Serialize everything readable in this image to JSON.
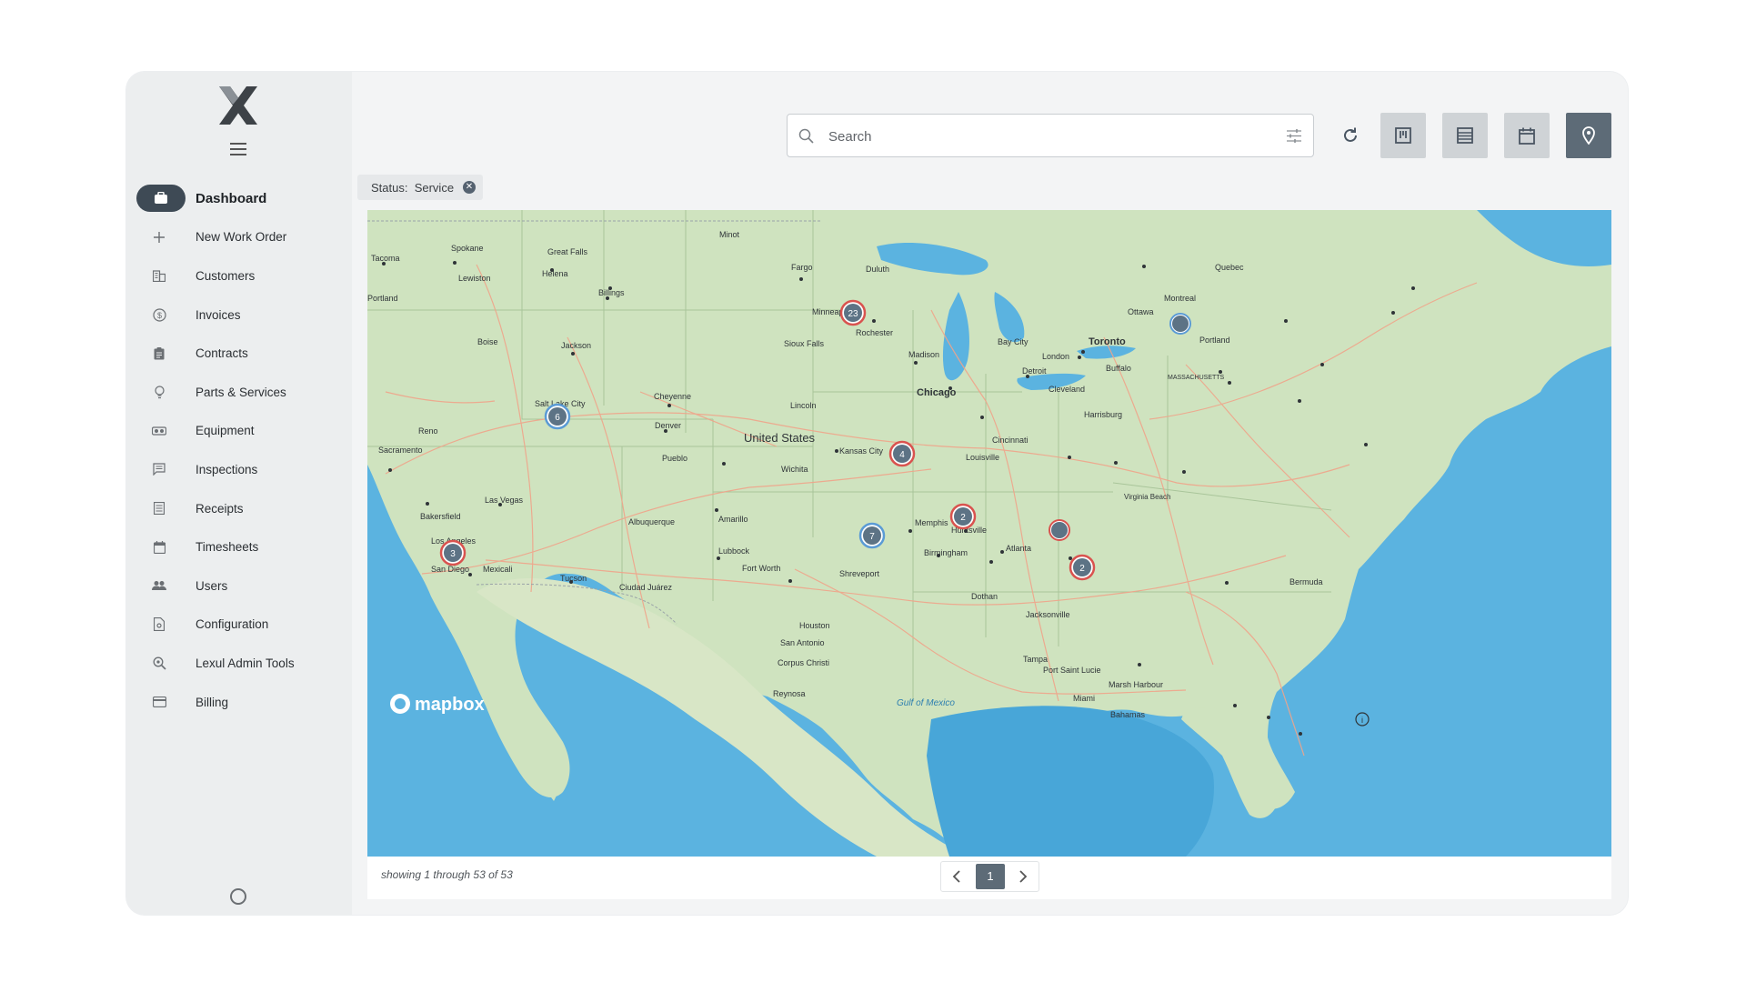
{
  "sidebar": {
    "items": [
      {
        "label": "Dashboard",
        "icon": "briefcase-icon"
      },
      {
        "label": "New Work Order",
        "icon": "plus-icon"
      },
      {
        "label": "Customers",
        "icon": "building-icon"
      },
      {
        "label": "Invoices",
        "icon": "dollar-circle-icon"
      },
      {
        "label": "Contracts",
        "icon": "clipboard-icon"
      },
      {
        "label": "Parts & Services",
        "icon": "lightbulb-icon"
      },
      {
        "label": "Equipment",
        "icon": "equipment-icon"
      },
      {
        "label": "Inspections",
        "icon": "comment-icon"
      },
      {
        "label": "Receipts",
        "icon": "receipt-icon"
      },
      {
        "label": "Timesheets",
        "icon": "calendar-icon"
      },
      {
        "label": "Users",
        "icon": "users-icon"
      },
      {
        "label": "Configuration",
        "icon": "file-settings-icon"
      },
      {
        "label": "Lexul Admin Tools",
        "icon": "search-gear-icon"
      },
      {
        "label": "Billing",
        "icon": "credit-card-icon"
      }
    ]
  },
  "search": {
    "placeholder": "Search"
  },
  "filter_chip": {
    "label": "Status:",
    "value": "Service"
  },
  "map": {
    "clusters": [
      {
        "count": "23",
        "color": "#d9534f"
      },
      {
        "count": "6",
        "color": "#5b9bd5"
      },
      {
        "count": "4",
        "color": "#d9534f"
      },
      {
        "count": "3",
        "color": "#d9534f"
      },
      {
        "count": "7",
        "color": "#5b9bd5"
      },
      {
        "count": "2",
        "color": "#d9534f"
      },
      {
        "count": "2",
        "color": "#d9534f"
      },
      {
        "count": "",
        "color": "#d9534f"
      },
      {
        "count": "",
        "color": "#5b9bd5"
      }
    ],
    "labels": {
      "united_states": "United States",
      "chicago": "Chicago",
      "toronto": "Toronto",
      "montreal": "Montreal",
      "ottawa": "Ottawa",
      "quebec": "Quebec",
      "detroit": "Detroit",
      "cleveland": "Cleveland",
      "buffalo": "Buffalo",
      "boston_region": "MASSACHUSETTS",
      "denver": "Denver",
      "kansas_city": "Kansas City",
      "minneapolis": "Minneap",
      "rochester": "Rochester",
      "madison": "Madison",
      "duluth": "Duluth",
      "fargo": "Fargo",
      "sioux_falls": "Sioux Falls",
      "lincoln": "Lincoln",
      "wichita": "Wichita",
      "louisville": "Louisville",
      "cincinnati": "Cincinnati",
      "memphis": "Memphis",
      "huntsville": "Huntsville",
      "atlanta": "Atlanta",
      "birmingham": "Birmingham",
      "dothan": "Dothan",
      "jacksonville": "Jacksonville",
      "tampa": "Tampa",
      "port_saint_lucie": "Port Saint Lucie",
      "miami": "Miami",
      "marsh_harbour": "Marsh Harbour",
      "bahamas": "Bahamas",
      "bermuda": "Bermuda",
      "virginia_beach": "Virginia Beach",
      "harrisburg": "Harrisburg",
      "portland_me": "Portland",
      "fort_worth": "Fort Worth",
      "shreveport": "Shreveport",
      "houston": "Houston",
      "san_antonio": "San Antonio",
      "corpus_christi": "Corpus Christi",
      "reynosa": "Reynosa",
      "amarillo": "Amarillo",
      "lubbock": "Lubbock",
      "albuquerque": "Albuquerque",
      "ciudad_juarez": "Ciudad Juárez",
      "tucson": "Tucson",
      "mexicali": "Mexicali",
      "san_diego": "San Diego",
      "los_angeles": "Los Angeles",
      "bakersfield": "Bakersfield",
      "las_vegas": "Las Vegas",
      "sacramento": "Sacramento",
      "reno": "Reno",
      "salt_lake_city": "Salt Lake City",
      "boise": "Boise",
      "jackson": "Jackson",
      "cheyenne": "Cheyenne",
      "pueblo": "Pueblo",
      "billings": "Billings",
      "helena": "Helena",
      "great_falls": "Great Falls",
      "spokane": "Spokane",
      "tacoma": "Tacoma",
      "lewiston": "Lewiston",
      "portland_or": "Portland",
      "minot": "Minot",
      "london": "London",
      "bay_city": "Bay City",
      "gulf_of_mexico": "Gulf of Mexico",
      "mapbox": "mapbox"
    }
  },
  "pagination": {
    "info": "showing 1 through 53 of 53",
    "current_page": "1"
  }
}
